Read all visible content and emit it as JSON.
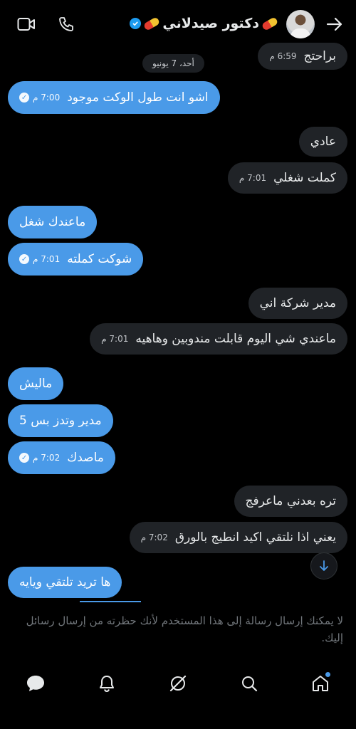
{
  "header": {
    "contact_name": "دكتور صيدلاني",
    "icons": [
      "video-call-icon",
      "phone-call-icon",
      "back-arrow-icon",
      "verified-badge-icon",
      "pill-emoji-icon"
    ]
  },
  "date_separator": "أحد، 7 يونيو",
  "messages": [
    {
      "side": "right",
      "text": "براحتج",
      "time": "6:59 م"
    },
    {
      "side": "left",
      "text": "اشو انت طول الوكت موجود",
      "time": "7:00 م",
      "read": true
    },
    {
      "side": "right",
      "text": "عادي",
      "time": ""
    },
    {
      "side": "right",
      "text": "كملت شغلي",
      "time": "7:01 م"
    },
    {
      "side": "left",
      "text": "ماعندك شغل",
      "time": ""
    },
    {
      "side": "left",
      "text": "شوكت كملته",
      "time": "7:01 م",
      "read": true
    },
    {
      "side": "right",
      "text": "مدير شركة اني",
      "time": ""
    },
    {
      "side": "right",
      "text": "ماعندي شي اليوم قابلت مندوبين وهاهيه",
      "time": "7:01 م"
    },
    {
      "side": "left",
      "text": "ماليش",
      "time": ""
    },
    {
      "side": "left",
      "text": "مدير وتدز بس 5",
      "time": ""
    },
    {
      "side": "left",
      "text": "ماصدك",
      "time": "7:02 م",
      "read": true
    },
    {
      "side": "right",
      "text": "تره بعدني ماعرفج",
      "time": ""
    },
    {
      "side": "right",
      "text": "يعني اذا نلتقي اكيد انطيج بالورق",
      "time": "7:02 م"
    },
    {
      "side": "left",
      "text": "ها تريد تلتقي ويايه",
      "time": ""
    }
  ],
  "blocked_notice": "لا يمكنك إرسال رسالة إلى هذا المستخدم لأنك حظرته من إرسال رسائل إليك.",
  "bottom_nav": [
    "messages-icon",
    "notifications-icon",
    "grok-icon",
    "search-icon",
    "home-icon"
  ],
  "colors": {
    "sent_bubble": "#4a9ae8",
    "received_bubble": "#202327",
    "background": "#000000",
    "accent": "#1d9bf0"
  }
}
